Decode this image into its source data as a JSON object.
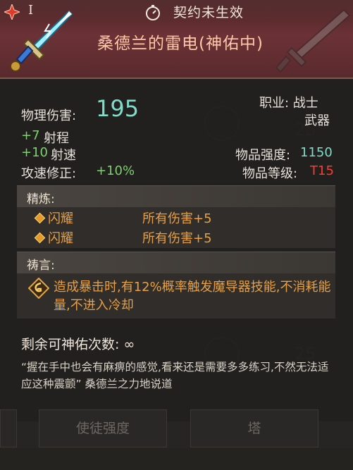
{
  "header": {
    "tier_label": "I",
    "contract_status": "契约未生效",
    "item_name": "桑德兰的雷电(神佑中)",
    "tier_icon": "red-star-icon",
    "clock_icon": "stopwatch-icon",
    "item_icon": "lightning-sword-icon"
  },
  "stats": {
    "physical_damage_label": "物理伤害:",
    "physical_damage_value": "195",
    "range_bonus": "+7",
    "range_label": "射程",
    "speed_bonus": "+10",
    "speed_label": "射速",
    "attack_speed_label": "攻速修正:",
    "attack_speed_value": "+10%",
    "class_label": "职业: 战士",
    "type_label": "武器",
    "item_power_label": "物品强度:",
    "item_power_value": "1150",
    "item_level_label": "物品等级:",
    "item_level_value": "T15"
  },
  "refine": {
    "title": "精炼:",
    "rows": [
      {
        "name": "闪耀",
        "effect": "所有伤害+5"
      },
      {
        "name": "闪耀",
        "effect": "所有伤害+5"
      }
    ]
  },
  "prayer": {
    "title": "祷言:",
    "text": "造成暴击时,有12%概率触发魔导器技能,不消耗能量,不进入冷却",
    "icon": "prayer-rune-icon"
  },
  "remaining": {
    "label": "剩余可神佑次数: ∞"
  },
  "flavor": {
    "text": "“握在手中也会有麻痹的感觉,看来还是需要多多练习,不然无法适应这种震颤”  桑德兰之力地说道"
  },
  "bottom": {
    "button_left": "使徒强度",
    "button_right": "塔"
  },
  "colors": {
    "header_red": "#6b3236",
    "item_name": "#ffc9a8",
    "teal_value": "#7fdcc8",
    "green_bonus": "#7ad46a",
    "orange_text": "#e8a042",
    "level_red": "#ff3b30"
  }
}
